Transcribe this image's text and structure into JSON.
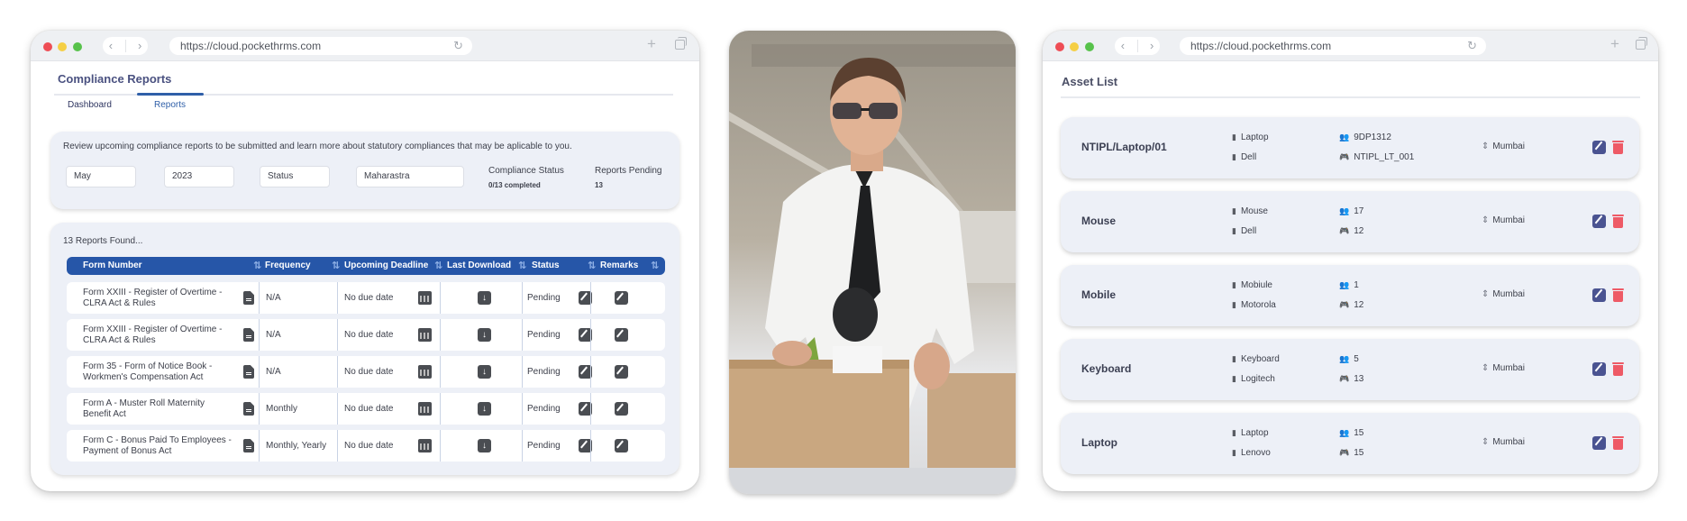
{
  "browser": {
    "url": "https://cloud.pockethrms.com"
  },
  "compliance": {
    "title": "Compliance Reports",
    "tabs": [
      {
        "label": "Dashboard",
        "active": false
      },
      {
        "label": "Reports",
        "active": true
      }
    ],
    "description": "Review upcoming compliance reports to be submitted and learn more about statutory compliances that may be aplicable to you.",
    "filters": {
      "month": "May",
      "year": "2023",
      "status": "Status",
      "state": "Maharastra"
    },
    "compliance_status": {
      "label": "Compliance Status",
      "value": "0/13 completed"
    },
    "reports_pending": {
      "label": "Reports Pending",
      "value": "13"
    },
    "found_text": "13 Reports Found...",
    "columns": [
      "Form Number",
      "Frequency",
      "Upcoming Deadline",
      "Last Download",
      "Status",
      "Remarks"
    ],
    "rows": [
      {
        "form": "Form XXIII - Register of Overtime - CLRA Act & Rules",
        "frequency": "N/A",
        "deadline": "No due date",
        "status": "Pending"
      },
      {
        "form": "Form XXIII - Register of Overtime - CLRA Act & Rules",
        "frequency": "N/A",
        "deadline": "No due date",
        "status": "Pending"
      },
      {
        "form": "Form 35 - Form of Notice Book - Workmen's Compensation Act",
        "frequency": "N/A",
        "deadline": "No due date",
        "status": "Pending"
      },
      {
        "form": "Form A - Muster Roll Maternity Benefit Act",
        "frequency": "Monthly",
        "deadline": "No due date",
        "status": "Pending"
      },
      {
        "form": "Form C - Bonus Paid To Employees - Payment of Bonus Act",
        "frequency": "Monthly, Yearly",
        "deadline": "No due date",
        "status": "Pending"
      }
    ],
    "colors": {
      "header": "#2656a8",
      "accent": "#2f5fa8"
    }
  },
  "photo": {
    "description": "Man in white shirt and black tie packing a cardboard box with plants in an office"
  },
  "assets": {
    "title": "Asset List",
    "items": [
      {
        "name": "NTIPL/Laptop/01",
        "type": "Laptop",
        "brand": "Dell",
        "assigned": "9DP1312",
        "code": "NTIPL_LT_001",
        "location": "Mumbai"
      },
      {
        "name": "Mouse",
        "type": "Mouse",
        "brand": "Dell",
        "assigned": "17",
        "code": "12",
        "location": "Mumbai"
      },
      {
        "name": "Mobile",
        "type": "Mobiule",
        "brand": "Motorola",
        "assigned": "1",
        "code": "12",
        "location": "Mumbai"
      },
      {
        "name": "Keyboard",
        "type": "Keyboard",
        "brand": "Logitech",
        "assigned": "5",
        "code": "13",
        "location": "Mumbai"
      },
      {
        "name": "Laptop",
        "type": "Laptop",
        "brand": "Lenovo",
        "assigned": "15",
        "code": "15",
        "location": "Mumbai"
      }
    ],
    "colors": {
      "edit": "#4a5391",
      "delete": "#ee5a66"
    }
  }
}
